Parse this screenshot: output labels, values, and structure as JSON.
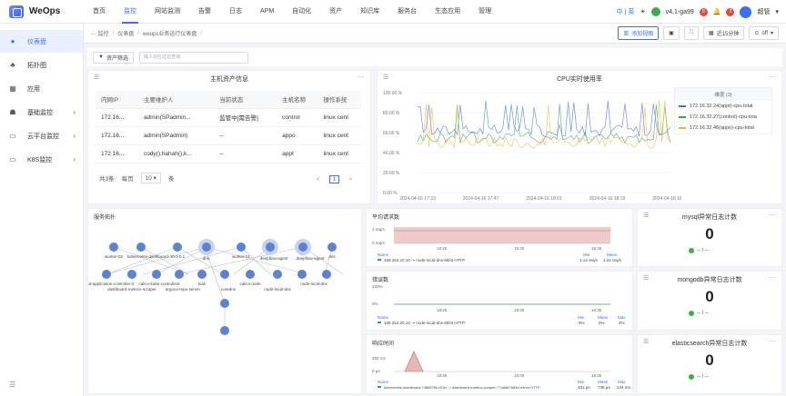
{
  "app": {
    "name": "WeOps"
  },
  "nav": [
    "首页",
    "监控",
    "网站监测",
    "告警",
    "日志",
    "APM",
    "自动化",
    "资产",
    "知识库",
    "服务台",
    "生态应用",
    "管理"
  ],
  "topbar": {
    "lang": "中 | 英",
    "version": "v4.1-ga99",
    "version_badge": "9",
    "notify_badge": "3",
    "user": "超管"
  },
  "sidebar": {
    "items": [
      {
        "label": "仪表盘",
        "icon": "dashboard-icon"
      },
      {
        "label": "拓扑图",
        "icon": "topology-icon"
      },
      {
        "label": "应用",
        "icon": "app-icon"
      },
      {
        "label": "基础监控",
        "icon": "monitor-icon"
      },
      {
        "label": "云平台监控",
        "icon": "cloud-icon"
      },
      {
        "label": "K8S监控",
        "icon": "k8s-icon"
      }
    ],
    "collapse_icon": "collapse-icon"
  },
  "breadcrumb": [
    "监控",
    "仪表盘",
    "weops业务运行仪表盘"
  ],
  "toolbar": {
    "add_view": "添加视图",
    "time_range": "近15分钟",
    "refresh": "off"
  },
  "filter": {
    "asset_button": "资产筛选",
    "placeholder": "输入对应过滤查询"
  },
  "host_panel": {
    "title": "主机资产信息",
    "columns": [
      "内网IP",
      "主要维护人",
      "当前状态",
      "主机名称",
      "操作系统"
    ],
    "rows": [
      [
        "172.16....",
        "admin(SPadmin...",
        "监管中[需告警]",
        "control",
        "linux cent"
      ],
      [
        "172.16....",
        "admin(SPadmin)",
        "--",
        "appo",
        "linux cent"
      ],
      [
        "172.16....",
        "cody(),hahah(),k...",
        "--",
        "appt",
        "linux cent"
      ]
    ],
    "pager": {
      "total": "共3条",
      "per_page_label": "每页",
      "per_page": "10",
      "unit": "条",
      "page": "1",
      "prev": "<",
      "next": ">"
    }
  },
  "cpu_panel": {
    "title": "CPU实时使用率",
    "legend_title": "维度 (3)",
    "series": [
      {
        "name": "172.16.32.24(appt)-cpu-total",
        "color": "#4a6bdc"
      },
      {
        "name": "172.16.32.27(control)-cpu-tota",
        "color": "#3aa05a"
      },
      {
        "name": "172.16.32.46(appo)-cpu-total",
        "color": "#e8b83a"
      }
    ],
    "y_ticks": [
      "100.00 %",
      "80.00 %",
      "60.00 %",
      "40.00 %",
      "20.00 %",
      "0.00 %"
    ],
    "x_ticks": [
      "2024-04-16 17:33",
      "2024-04-16 17:47",
      "2024-04-16 18:01",
      "2024-04-16 18:15",
      "2024-04-16 18:29"
    ]
  },
  "topology": {
    "title": "服务拓扑",
    "nodes_top": [
      "worker-02",
      "kubernetes-dashboard-",
      "10.0.0.1",
      "dns-",
      "worker-01",
      "deepflow-agent",
      "deepflow-agent",
      "dns"
    ],
    "nodes_bottom": [
      "argocd-application-controller-0",
      "dashboard-metrics-scraper",
      "calico-kube-controllers",
      "argocd-repo-server",
      "kiali",
      "coredns",
      "calico-node",
      "node-local-dns",
      "node-local-dns"
    ]
  },
  "latency_panel": {
    "title": "平均请求数",
    "y_ticks": [
      "1 req/s",
      "0 req/s"
    ],
    "x_ticks": [
      "18:25",
      "18:30",
      "18:35"
    ],
    "legend_cols": [
      "Name",
      "Min",
      "Mean"
    ],
    "row": {
      "name": "169.254.20.10 -> node-local-dns-6kf4t HTTP",
      "min": "1.13 req/s",
      "mean": "1.22 req/s"
    }
  },
  "error_panel": {
    "title": "错误数",
    "y_ticks": [
      "100%",
      "0%"
    ],
    "x_ticks": [
      "18:25",
      "18:30",
      "18:35"
    ],
    "legend_cols": [
      "Name",
      "Min",
      "Mean",
      "Max"
    ],
    "row": {
      "name": "169.254.20.10 -> node-local-dns-6kf4t HTTP",
      "min": "0%",
      "mean": "0%",
      "max": "0%"
    }
  },
  "resp_panel": {
    "title": "响应时间",
    "y_ticks": [
      "250 ms",
      "0 μs"
    ],
    "x_ticks": [
      "18:25",
      "18:30",
      "18:35"
    ],
    "legend_cols": [
      "Name",
      "Min",
      "Mean",
      "Max"
    ],
    "row": {
      "name": "kubernetes-dashboard-74f6f97f6-nf7dv -> dashboard-metrics-scraper-77ddd67b84d-rfzmn HTTP",
      "min": "331 μs",
      "mean": "736 μs",
      "max": "134 ms"
    }
  },
  "stats": [
    {
      "title": "mysql异常日志计数",
      "value": "0",
      "foot": "-- / --"
    },
    {
      "title": "mongodb异常日志计数",
      "value": "0",
      "foot": "-- / --"
    },
    {
      "title": "elasticsearch异常日志计数",
      "value": "0",
      "foot": "-- / --"
    }
  ]
}
